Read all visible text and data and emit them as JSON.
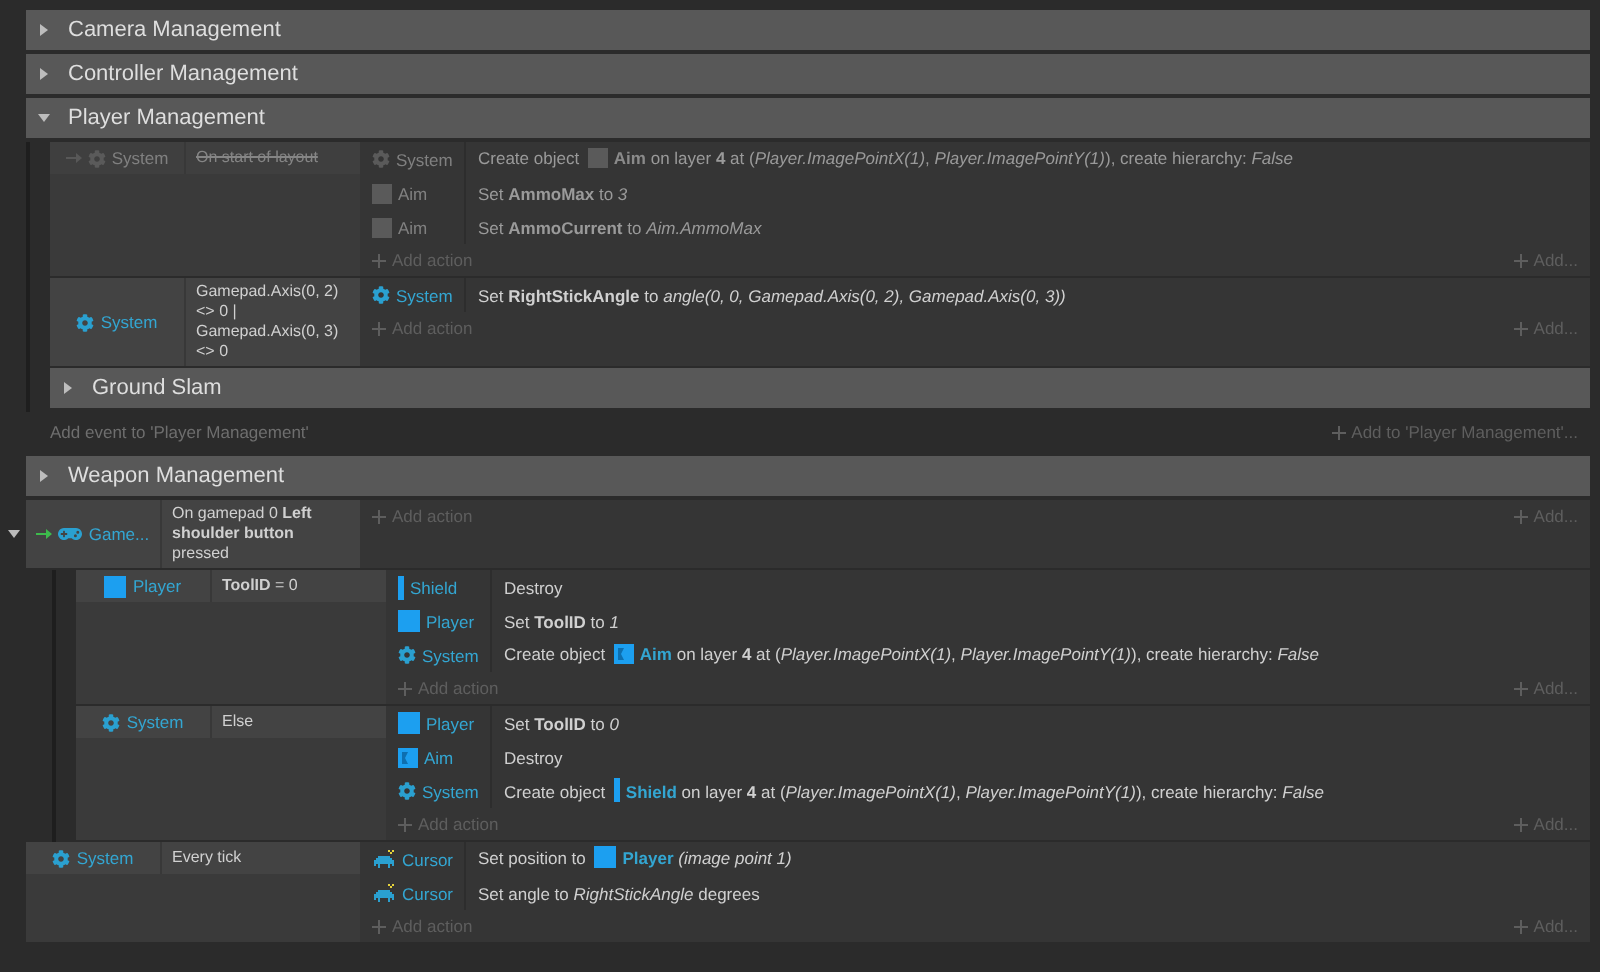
{
  "sheet": [
    {
      "kind": "group",
      "title": "Camera Management",
      "expanded": false
    },
    {
      "kind": "group",
      "title": "Controller Management",
      "expanded": false
    },
    {
      "kind": "group",
      "title": "Player Management",
      "expanded": true,
      "add_event": "Add event to 'Player Management'",
      "add_to": "Add to 'Player Management'...",
      "items": [
        {
          "kind": "event",
          "disabled": true,
          "trigger": true,
          "conditions": [
            {
              "object": "System",
              "kind": "system",
              "text": "On start of layout"
            }
          ],
          "actions": [
            {
              "object": "System",
              "kind": "system",
              "parts": [
                {
                  "kind": "text",
                  "text": "Create object "
                },
                {
                  "kind": "aim",
                  "object": "Aim"
                },
                {
                  "kind": "text",
                  "text": " on layer **4** at (*Player.ImagePointX(1)*, *Player.ImagePointY(1)*), create hierarchy: *False*"
                }
              ]
            },
            {
              "object": "Aim",
              "kind": "aim",
              "parts": [
                {
                  "kind": "text",
                  "text": "Set **AmmoMax** to *3*"
                }
              ]
            },
            {
              "object": "Aim",
              "kind": "aim",
              "parts": [
                {
                  "kind": "text",
                  "text": "Set **AmmoCurrent** to *Aim.AmmoMax*"
                }
              ]
            }
          ],
          "add_action": "Add action",
          "add_more": "Add..."
        },
        {
          "kind": "event",
          "disabled": false,
          "trigger": false,
          "conditions": [
            {
              "object": "System",
              "kind": "system",
              "text": "Gamepad.Axis(0, 2) <> 0 | Gamepad.Axis(0, 3) <> 0"
            }
          ],
          "actions": [
            {
              "object": "System",
              "kind": "system",
              "parts": [
                {
                  "kind": "text",
                  "text": "Set **RightStickAngle** to *angle(0, 0, Gamepad.Axis(0, 2), Gamepad.Axis(0, 3))*"
                }
              ]
            }
          ],
          "add_action": "Add action",
          "add_more": "Add..."
        },
        {
          "kind": "group",
          "title": "Ground Slam",
          "expanded": false
        }
      ]
    },
    {
      "kind": "group",
      "title": "Weapon Management",
      "expanded": false
    },
    {
      "kind": "event",
      "disabled": false,
      "trigger": true,
      "expanded": true,
      "conditions": [
        {
          "object": "Game...",
          "kind": "gamepad",
          "text": "On gamepad 0 **Left shoulder button** pressed"
        }
      ],
      "add_action": "Add action",
      "add_more": "Add...",
      "children": [
        {
          "kind": "event",
          "disabled": false,
          "trigger": false,
          "conditions": [
            {
              "object": "Player",
              "kind": "sprite",
              "text": "**ToolID** = 0"
            }
          ],
          "actions": [
            {
              "object": "Shield",
              "kind": "shield",
              "parts": [
                {
                  "kind": "text",
                  "text": "Destroy"
                }
              ]
            },
            {
              "object": "Player",
              "kind": "sprite",
              "parts": [
                {
                  "kind": "text",
                  "text": "Set **ToolID** to *1*"
                }
              ]
            },
            {
              "object": "System",
              "kind": "system",
              "parts": [
                {
                  "kind": "text",
                  "text": "Create object "
                },
                {
                  "kind": "aim",
                  "object": "Aim"
                },
                {
                  "kind": "text",
                  "text": " on layer **4** at (*Player.ImagePointX(1)*, *Player.ImagePointY(1)*), create hierarchy: *False*"
                }
              ]
            }
          ],
          "add_action": "Add action",
          "add_more": "Add..."
        },
        {
          "kind": "event",
          "disabled": false,
          "trigger": false,
          "conditions": [
            {
              "object": "System",
              "kind": "system",
              "text": "Else"
            }
          ],
          "actions": [
            {
              "object": "Player",
              "kind": "sprite",
              "parts": [
                {
                  "kind": "text",
                  "text": "Set **ToolID** to *0*"
                }
              ]
            },
            {
              "object": "Aim",
              "kind": "aim",
              "parts": [
                {
                  "kind": "text",
                  "text": "Destroy"
                }
              ]
            },
            {
              "object": "System",
              "kind": "system",
              "parts": [
                {
                  "kind": "text",
                  "text": "Create object "
                },
                {
                  "kind": "shield",
                  "object": "Shield"
                },
                {
                  "kind": "text",
                  "text": " on layer **4** at (*Player.ImagePointX(1)*, *Player.ImagePointY(1)*), create hierarchy: *False*"
                }
              ]
            }
          ],
          "add_action": "Add action",
          "add_more": "Add..."
        }
      ]
    },
    {
      "kind": "event",
      "disabled": false,
      "trigger": false,
      "conditions": [
        {
          "object": "System",
          "kind": "system",
          "text": "Every tick"
        }
      ],
      "actions": [
        {
          "object": "Cursor",
          "kind": "cursor",
          "parts": [
            {
              "kind": "text",
              "text": "Set position to "
            },
            {
              "kind": "sprite",
              "object": "Player"
            },
            {
              "kind": "text",
              "text": " *(image point 1)*"
            }
          ]
        },
        {
          "object": "Cursor",
          "kind": "cursor",
          "parts": [
            {
              "kind": "text",
              "text": "Set angle to *RightStickAngle* degrees"
            }
          ]
        }
      ],
      "add_action": "Add action",
      "add_more": "Add..."
    }
  ]
}
